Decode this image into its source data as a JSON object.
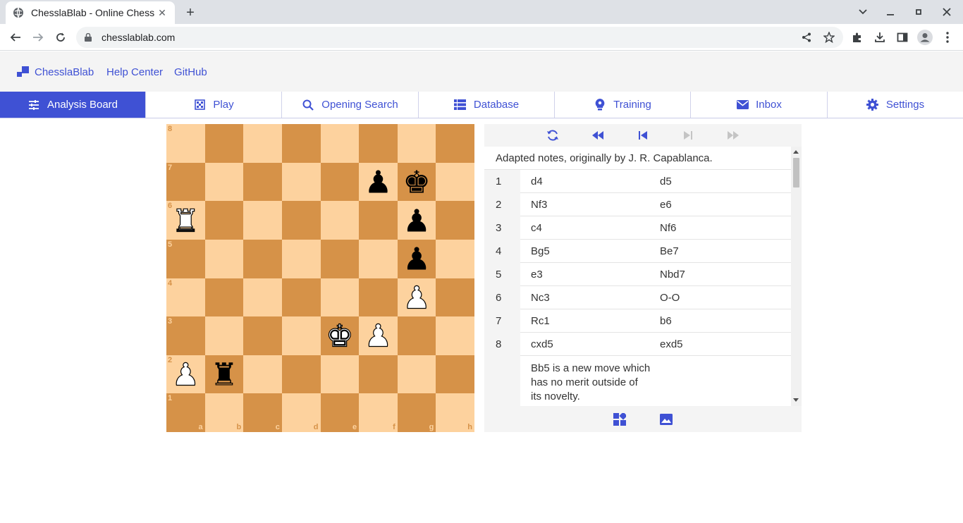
{
  "browser": {
    "tab_title": "ChesslaBlab - Online Chess",
    "url": "chesslablab.com"
  },
  "site": {
    "brand": "ChesslaBlab",
    "links": [
      "Help Center",
      "GitHub"
    ],
    "accent_color": "#3f51d4"
  },
  "nav": [
    {
      "label": "Analysis Board",
      "icon": "sliders-icon",
      "active": true
    },
    {
      "label": "Play",
      "icon": "grid-board-icon",
      "active": false
    },
    {
      "label": "Opening Search",
      "icon": "search-icon",
      "active": false
    },
    {
      "label": "Database",
      "icon": "list-icon",
      "active": false
    },
    {
      "label": "Training",
      "icon": "lightbulb-icon",
      "active": false
    },
    {
      "label": "Inbox",
      "icon": "envelope-icon",
      "active": false
    },
    {
      "label": "Settings",
      "icon": "gear-icon",
      "active": false
    }
  ],
  "board": {
    "light_color": "#fdd29e",
    "dark_color": "#d69248",
    "ranks": [
      "8",
      "7",
      "6",
      "5",
      "4",
      "3",
      "2",
      "1"
    ],
    "files": [
      "a",
      "b",
      "c",
      "d",
      "e",
      "f",
      "g",
      "h"
    ],
    "pieces": [
      {
        "sq": "f7",
        "glyph": "♟",
        "color": "b"
      },
      {
        "sq": "g7",
        "glyph": "♚",
        "color": "b"
      },
      {
        "sq": "a6",
        "glyph": "♜",
        "color": "w"
      },
      {
        "sq": "g6",
        "glyph": "♟",
        "color": "b"
      },
      {
        "sq": "g5",
        "glyph": "♟",
        "color": "b"
      },
      {
        "sq": "g4",
        "glyph": "♟",
        "color": "w"
      },
      {
        "sq": "e3",
        "glyph": "♚",
        "color": "w"
      },
      {
        "sq": "f3",
        "glyph": "♟",
        "color": "w"
      },
      {
        "sq": "a2",
        "glyph": "♟",
        "color": "w"
      },
      {
        "sq": "b2",
        "glyph": "♜",
        "color": "b"
      }
    ]
  },
  "moves": {
    "comment": "Adapted notes, originally by J. R. Capablanca.",
    "rows": [
      {
        "n": "1",
        "w": "d4",
        "b": "d5"
      },
      {
        "n": "2",
        "w": "Nf3",
        "b": "e6"
      },
      {
        "n": "3",
        "w": "c4",
        "b": "Nf6"
      },
      {
        "n": "4",
        "w": "Bg5",
        "b": "Be7"
      },
      {
        "n": "5",
        "w": "e3",
        "b": "Nbd7"
      },
      {
        "n": "6",
        "w": "Nc3",
        "b": "O-O"
      },
      {
        "n": "7",
        "w": "Rc1",
        "b": "b6"
      },
      {
        "n": "8",
        "w": "cxd5",
        "b": "exd5"
      }
    ],
    "note": "Bb5 is a new move which has no merit outside of its novelty."
  }
}
